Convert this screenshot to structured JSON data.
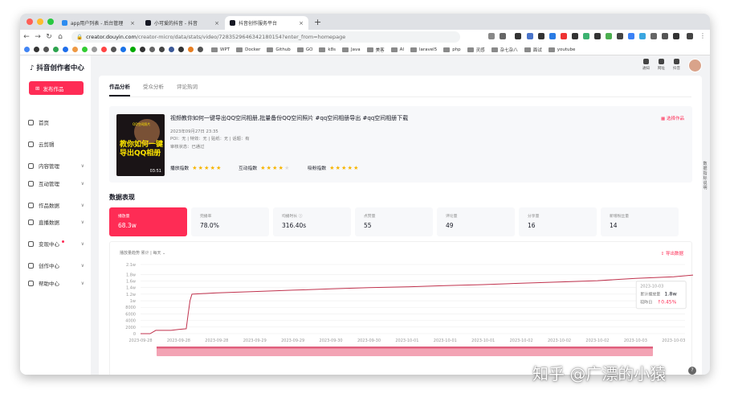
{
  "browser": {
    "tabs": [
      {
        "title": "app用户列表 - 后台管理",
        "active": false
      },
      {
        "title": "小可爱的抖音 - 抖音",
        "active": false
      },
      {
        "title": "抖音创作服务平台",
        "active": true
      }
    ],
    "url_host": "creator.douyin.com",
    "url_path": "/creator-micro/data/stats/video/7283529646342180154?enter_from=homepage",
    "bookmarks": [
      "WPT",
      "Docker",
      "Github",
      "GO",
      "k8s",
      "Java",
      "美客",
      "AI",
      "laravel5",
      "php",
      "灵感",
      "杂七杂八",
      "面试",
      "youtube"
    ]
  },
  "sidebar": {
    "logo": "抖音创作者中心",
    "publish_label": "发布作品",
    "items": [
      {
        "label": "首页",
        "chev": ""
      },
      {
        "label": "云剪辑",
        "chev": ""
      },
      {
        "label": "内容管理",
        "chev": "∨"
      },
      {
        "label": "互动管理",
        "chev": "∨"
      },
      {
        "label": "作品数据",
        "chev": "∨"
      },
      {
        "label": "直播数据",
        "chev": "∨"
      },
      {
        "label": "变现中心",
        "chev": "∨"
      },
      {
        "label": "创作中心",
        "chev": "∨"
      },
      {
        "label": "帮助中心",
        "chev": "∨"
      }
    ]
  },
  "header": {
    "actions": [
      "通知",
      "网址",
      "抖音"
    ]
  },
  "content_tabs": [
    "作品分析",
    "受众分析",
    "评论热词"
  ],
  "video": {
    "title": "视频教你如何一键导出QQ空间相册,批量备份QQ空间照片 #qq空间相册导出 #qq空间相册下载",
    "date": "2023年09月27日 23:35",
    "tags": "POI：无 | 特效：无 | 贴纸：无 | 话题：有",
    "review": "审核状态：已通过",
    "thumb_caption": "QQ空间照片",
    "thumb_text": "教你如何一键导出QQ相册",
    "thumb_duration": "03:51",
    "scores": [
      {
        "label": "播放指数",
        "stars": 5
      },
      {
        "label": "互动指数",
        "stars": 3.5
      },
      {
        "label": "吸粉指数",
        "stars": 5
      }
    ],
    "select_label": "选择作品"
  },
  "section_title": "数据表现",
  "metrics": [
    {
      "label": "播放量",
      "value": "68.3w",
      "active": true
    },
    {
      "label": "完播率",
      "value": "78.0%"
    },
    {
      "label": "均播时长 ⓘ",
      "value": "316.40s"
    },
    {
      "label": "点赞量",
      "value": "55"
    },
    {
      "label": "评论量",
      "value": "49"
    },
    {
      "label": "分享量",
      "value": "16"
    },
    {
      "label": "新增粉丝量",
      "value": "14"
    }
  ],
  "chart_controls": "播放量趋势 累计 | 每天 ⌄",
  "export_label": "导出数据",
  "chart_data": {
    "type": "line",
    "y_ticks": [
      "0",
      "2000",
      "4000",
      "6000",
      "8000",
      "1w",
      "1.2w",
      "1.4w",
      "1.6w",
      "1.8w",
      "2.1w"
    ],
    "ylim": [
      0,
      21000
    ],
    "x_ticks": [
      "2023-09-28",
      "2023-09-28",
      "2023-09-28",
      "2023-09-29",
      "2023-09-29",
      "2023-09-30",
      "2023-09-30",
      "2023-10-01",
      "2023-10-01",
      "2023-10-01",
      "2023-10-02",
      "2023-10-02",
      "2023-10-02",
      "2023-10-03",
      "2023-10-03"
    ],
    "series": [
      {
        "color": "#c0324d",
        "points": [
          [
            0,
            0
          ],
          [
            0.25,
            0
          ],
          [
            0.4,
            1000
          ],
          [
            0.8,
            1000
          ],
          [
            1.0,
            1300
          ],
          [
            1.2,
            1500
          ],
          [
            1.25,
            6000
          ],
          [
            1.3,
            10000
          ],
          [
            1.35,
            12000
          ],
          [
            2.0,
            12400
          ],
          [
            3.0,
            12800
          ],
          [
            4.0,
            13200
          ],
          [
            5.0,
            13600
          ],
          [
            6.0,
            14000
          ],
          [
            7.0,
            14200
          ],
          [
            8.0,
            14600
          ],
          [
            9.0,
            14900
          ],
          [
            10.0,
            15300
          ],
          [
            11.0,
            15700
          ],
          [
            12.0,
            16100
          ],
          [
            13.0,
            16800
          ],
          [
            14.0,
            17300
          ],
          [
            14.6,
            17900
          ],
          [
            15.3,
            18600
          ]
        ]
      }
    ],
    "tooltip": {
      "date": "2023-10-03",
      "label": "累计播放量",
      "value": "1.8w",
      "compare_label": "较昨日",
      "compare_value": "↑0.45%",
      "x": 14.6,
      "y": 17900
    }
  },
  "side_tool": "数据指标说明",
  "watermark": "知乎 @广漂的小猿"
}
